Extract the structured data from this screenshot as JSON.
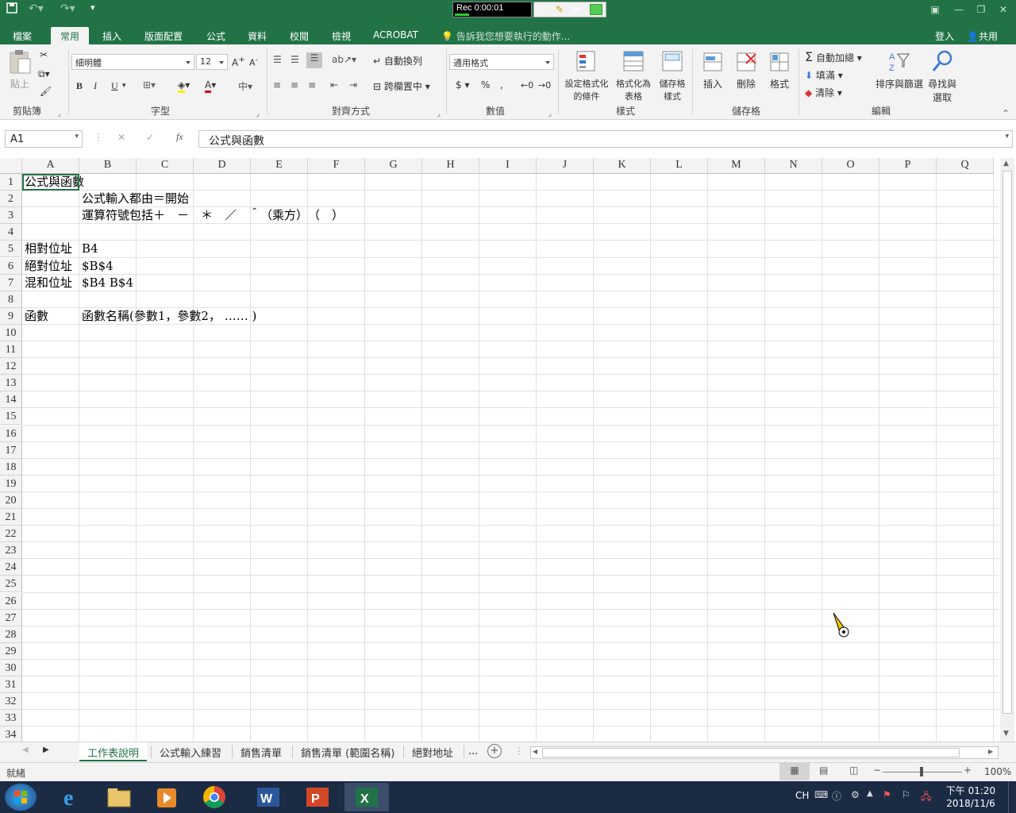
{
  "recorder": {
    "time": "Rec 0:00:01"
  },
  "tabs": [
    "檔案",
    "常用",
    "插入",
    "版面配置",
    "公式",
    "資料",
    "校閱",
    "檢視",
    "ACROBAT"
  ],
  "tell_me": "告訴我您想要執行的動作...",
  "account": {
    "signin": "登入",
    "share": "共用"
  },
  "ribbon": {
    "clipboard": {
      "paste": "貼上",
      "label": "剪貼簿"
    },
    "font": {
      "name": "細明體",
      "size": "12",
      "label": "字型",
      "bold": "B",
      "italic": "I",
      "underline": "U"
    },
    "alignment": {
      "wrap": "自動換列",
      "merge": "跨欄置中",
      "label": "對齊方式"
    },
    "number": {
      "format": "通用格式",
      "label": "數值"
    },
    "styles": {
      "cond1": "設定格式化",
      "cond2": "的條件",
      "table1": "格式化為",
      "table2": "表格",
      "cell1": "儲存格",
      "cell2": "樣式",
      "label": "樣式"
    },
    "cells": {
      "insert": "插入",
      "delete": "刪除",
      "format": "格式",
      "label": "儲存格"
    },
    "editing": {
      "autosum": "自動加總",
      "fill": "填滿",
      "clear": "清除",
      "sort": "排序與篩選",
      "find1": "尋找與",
      "find2": "選取",
      "label": "編輯"
    }
  },
  "formula_bar": {
    "name_box": "A1",
    "content": "公式與函數"
  },
  "columns": [
    "A",
    "B",
    "C",
    "D",
    "E",
    "F",
    "G",
    "H",
    "I",
    "J",
    "K",
    "L",
    "M",
    "N",
    "O",
    "P",
    "Q"
  ],
  "row_count": 34,
  "cells": {
    "A1": "公式與函數",
    "B2": "公式輸入都由＝開始",
    "B3": "運算符號包括＋　－　＊　／　＾（乘方）　（　）",
    "A5": "相對位址",
    "B5": "B4",
    "A6": "絕對位址",
    "B6": "$B$4",
    "A7": "混和位址",
    "B7": "$B4  B$4",
    "A9": "函數",
    "B9": "函數名稱(參數1，參數2，  ……  )"
  },
  "sheets": [
    "工作表說明",
    "公式輸入練習",
    "銷售清單",
    "銷售清單 (範圍名稱)",
    "絕對地址"
  ],
  "sheets_more": "...",
  "status": {
    "ready": "就緒",
    "zoom": "100%"
  },
  "taskbar": {
    "lang": "CH",
    "time": "下午 01:20",
    "date": "2018/11/6"
  }
}
